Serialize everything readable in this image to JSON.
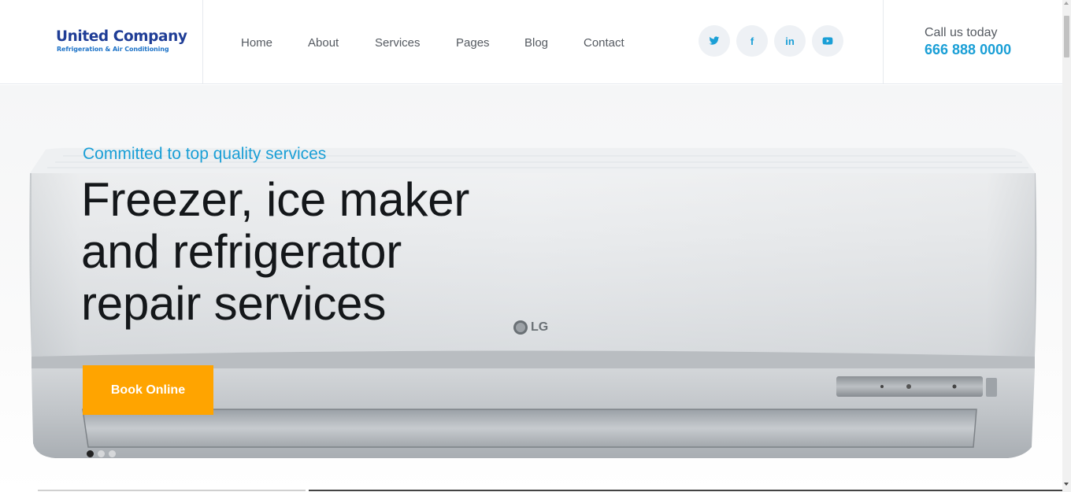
{
  "brand": {
    "name": "United Company",
    "tagline": "Refrigeration & Air Conditioning",
    "name_color": "#1f3d96",
    "tagline_color": "#1f74c8"
  },
  "nav": {
    "items": [
      {
        "label": "Home"
      },
      {
        "label": "About"
      },
      {
        "label": "Services"
      },
      {
        "label": "Pages"
      },
      {
        "label": "Blog"
      },
      {
        "label": "Contact"
      }
    ]
  },
  "social": {
    "items": [
      {
        "icon": "twitter-icon"
      },
      {
        "icon": "facebook-icon",
        "glyph": "f"
      },
      {
        "icon": "linkedin-icon",
        "glyph": "in"
      },
      {
        "icon": "youtube-icon"
      }
    ]
  },
  "contact": {
    "label": "Call us today",
    "phone": "666 888 0000"
  },
  "hero": {
    "subtitle": "Committed to top quality services",
    "headline": [
      "Freezer, ice maker",
      "and refrigerator",
      "repair services"
    ],
    "cta_label": "Book Online",
    "product_brand": "LG",
    "slide_count": 3,
    "active_slide": 1
  },
  "colors": {
    "accent": "#1a9fd6",
    "cta": "#ffa400",
    "heading": "#14171a",
    "nav_text": "#555a61"
  }
}
